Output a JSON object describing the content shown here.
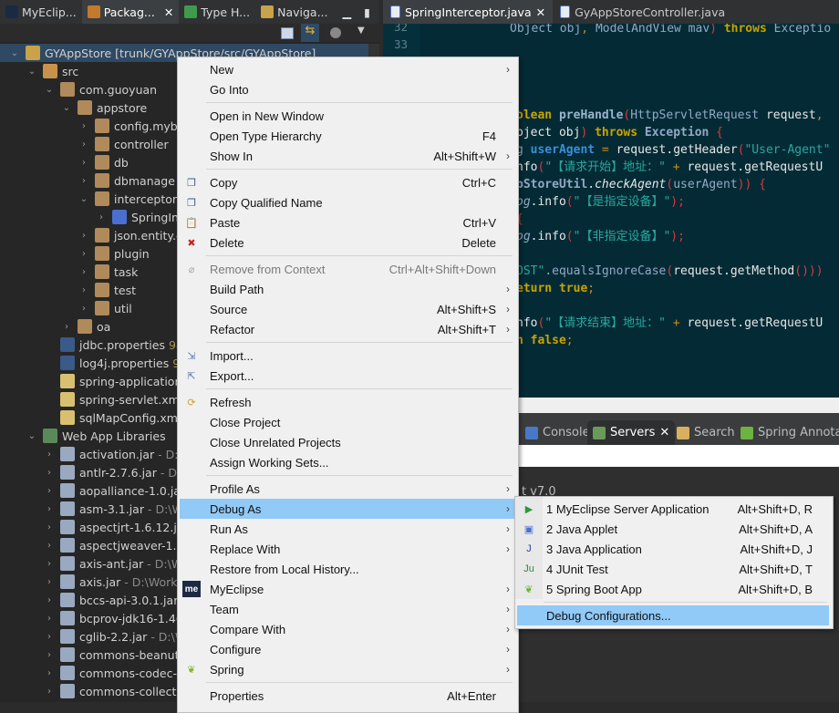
{
  "left_tabs": [
    {
      "label": "MyEclip...",
      "icon": "myeclipse-icon",
      "color": "#1b2a44"
    },
    {
      "label": "Packag...",
      "icon": "package-explorer-icon",
      "color": "#c47a2c",
      "active": true,
      "close": "✕"
    },
    {
      "label": "Type H...",
      "icon": "type-hierarchy-icon",
      "color": "#3f9a4d"
    },
    {
      "label": "Naviga...",
      "icon": "navigator-icon",
      "color": "#c9a24a"
    }
  ],
  "editor_tabs": [
    {
      "label": "SpringInterceptor.java",
      "active": true,
      "close": "✕"
    },
    {
      "label": "GyAppStoreController.java"
    }
  ],
  "tree": [
    {
      "label": "GYAppStore [trunk/GYAppStore/src/GYAppStore]",
      "level": 0,
      "exp": "v",
      "icon": "project-icon",
      "selected": true
    },
    {
      "label": "src",
      "level": 1,
      "exp": "v",
      "icon": "source-folder-icon"
    },
    {
      "label": "com.guoyuan",
      "level": 2,
      "exp": "v",
      "icon": "package-icon"
    },
    {
      "label": "appstore",
      "level": 3,
      "exp": "v",
      "icon": "package-icon"
    },
    {
      "label": "config.myba",
      "level": 4,
      "exp": ">",
      "icon": "package-icon"
    },
    {
      "label": "controller",
      "level": 4,
      "exp": ">",
      "icon": "package-icon"
    },
    {
      "label": "db",
      "level": 4,
      "exp": ">",
      "icon": "package-icon"
    },
    {
      "label": "dbmanage",
      "level": 4,
      "exp": ">",
      "icon": "package-icon"
    },
    {
      "label": "interceptor",
      "level": 4,
      "exp": "v",
      "icon": "package-icon"
    },
    {
      "label": "SpringIn",
      "level": 5,
      "exp": ">",
      "icon": "java-file-icon"
    },
    {
      "label": "json.entity.d",
      "level": 4,
      "exp": ">",
      "icon": "package-icon"
    },
    {
      "label": "plugin",
      "level": 4,
      "exp": ">",
      "icon": "package-icon"
    },
    {
      "label": "task",
      "level": 4,
      "exp": ">",
      "icon": "package-icon"
    },
    {
      "label": "test",
      "level": 4,
      "exp": ">",
      "icon": "package-icon"
    },
    {
      "label": "util",
      "level": 4,
      "exp": ">",
      "icon": "package-icon"
    },
    {
      "label": "oa",
      "level": 3,
      "exp": ">",
      "icon": "package-icon"
    },
    {
      "label": "jdbc.properties",
      "level": 2,
      "exp": "",
      "icon": "properties-file-icon",
      "deco": "98",
      "decoNum": true
    },
    {
      "label": "log4j.properties",
      "level": 2,
      "exp": "",
      "icon": "properties-file-icon",
      "deco": "98",
      "decoNum": true
    },
    {
      "label": "spring-application",
      "level": 2,
      "exp": "",
      "icon": "xml-file-icon"
    },
    {
      "label": "spring-servlet.xml",
      "level": 2,
      "exp": "",
      "icon": "xml-file-icon"
    },
    {
      "label": "sqlMapConfig.xml",
      "level": 2,
      "exp": "",
      "icon": "xml-file-icon"
    },
    {
      "label": "Web App Libraries",
      "level": 1,
      "exp": "v",
      "icon": "library-icon"
    },
    {
      "label": "activation.jar",
      "level": 2,
      "exp": ">",
      "icon": "jar-icon",
      "deco": "- D:\\W"
    },
    {
      "label": "antlr-2.7.6.jar",
      "level": 2,
      "exp": ">",
      "icon": "jar-icon",
      "deco": "- D:\\"
    },
    {
      "label": "aopalliance-1.0.jar",
      "level": 2,
      "exp": ">",
      "icon": "jar-icon"
    },
    {
      "label": "asm-3.1.jar",
      "level": 2,
      "exp": ">",
      "icon": "jar-icon",
      "deco": "- D:\\W"
    },
    {
      "label": "aspectjrt-1.6.12.jar",
      "level": 2,
      "exp": ">",
      "icon": "jar-icon"
    },
    {
      "label": "aspectjweaver-1.6.",
      "level": 2,
      "exp": ">",
      "icon": "jar-icon"
    },
    {
      "label": "axis-ant.jar",
      "level": 2,
      "exp": ">",
      "icon": "jar-icon",
      "deco": "- D:\\W"
    },
    {
      "label": "axis.jar",
      "level": 2,
      "exp": ">",
      "icon": "jar-icon",
      "deco": "- D:\\WorkS"
    },
    {
      "label": "bccs-api-3.0.1.jar",
      "level": 2,
      "exp": ">",
      "icon": "jar-icon",
      "deco": "-"
    },
    {
      "label": "bcprov-jdk16-1.46",
      "level": 2,
      "exp": ">",
      "icon": "jar-icon"
    },
    {
      "label": "cglib-2.2.jar",
      "level": 2,
      "exp": ">",
      "icon": "jar-icon",
      "deco": "- D:\\W"
    },
    {
      "label": "commons-beanutil",
      "level": 2,
      "exp": ">",
      "icon": "jar-icon"
    },
    {
      "label": "commons-codec-1",
      "level": 2,
      "exp": ">",
      "icon": "jar-icon"
    },
    {
      "label": "commons-collectio",
      "level": 2,
      "exp": ">",
      "icon": "jar-icon"
    }
  ],
  "editor": {
    "line_numbers": [
      "32",
      "33"
    ],
    "lines": [
      {
        "row": 0,
        "left": "full",
        "segs": [
          [
            "Object obj",
            "type"
          ],
          [
            ", ",
            "op"
          ],
          [
            "ModelAndView mav",
            "type"
          ],
          [
            ")",
            "br"
          ],
          [
            " throws ",
            "kw"
          ],
          [
            "Exceptio",
            "type"
          ]
        ]
      },
      {
        "row": 5,
        "segs": [
          [
            "olean",
            "kw"
          ],
          [
            " preHandle",
            "method"
          ],
          [
            "(",
            "br"
          ],
          [
            "HttpServletRequest",
            "type"
          ],
          [
            " request",
            "plain"
          ],
          [
            ",",
            "op"
          ]
        ]
      },
      {
        "row": 6,
        "segs": [
          [
            "bject obj",
            "plain"
          ],
          [
            ")",
            "br"
          ],
          [
            " throws ",
            "kw"
          ],
          [
            "Exception",
            "tb"
          ],
          [
            " {",
            "br"
          ]
        ]
      },
      {
        "row": 7,
        "segs": [
          [
            "g ",
            "type"
          ],
          [
            "userAgent",
            "var"
          ],
          [
            " = ",
            "op"
          ],
          [
            "request.getHeader",
            "plain"
          ],
          [
            "(",
            "br"
          ],
          [
            "\"User-Agent\"",
            "str"
          ]
        ]
      },
      {
        "row": 8,
        "segs": [
          [
            "nfo",
            "plain"
          ],
          [
            "(",
            "br"
          ],
          [
            "\"【请求开始】地址：\"",
            "str"
          ],
          [
            " + ",
            "op"
          ],
          [
            "request.getRequestU",
            "plain"
          ]
        ]
      },
      {
        "row": 9,
        "segs": [
          [
            "pStoreUtil",
            "tb"
          ],
          [
            ".",
            "plain"
          ],
          [
            "checkAgent",
            "plain it"
          ],
          [
            "(",
            "br"
          ],
          [
            "userAgent",
            "type"
          ],
          [
            ")) {",
            "br"
          ]
        ]
      },
      {
        "row": 10,
        "segs": [
          [
            "og",
            "type it"
          ],
          [
            ".info",
            "plain"
          ],
          [
            "(",
            "br"
          ],
          [
            "\"【是指定设备】\"",
            "str"
          ],
          [
            ");",
            "br"
          ]
        ]
      },
      {
        "row": 11,
        "segs": [
          [
            "{",
            "br"
          ]
        ]
      },
      {
        "row": 12,
        "segs": [
          [
            "og",
            "type it"
          ],
          [
            ".info",
            "plain"
          ],
          [
            "(",
            "br"
          ],
          [
            "\"【非指定设备】\"",
            "str"
          ],
          [
            ");",
            "br"
          ]
        ]
      },
      {
        "row": 14,
        "segs": [
          [
            "OST\"",
            "str"
          ],
          [
            ".equalsIgnoreCase",
            "type"
          ],
          [
            "(",
            "br"
          ],
          [
            "request.getMethod",
            "plain"
          ],
          [
            "()))",
            "br"
          ]
        ]
      },
      {
        "row": 15,
        "segs": [
          [
            "eturn true",
            "kw"
          ],
          [
            ";",
            "op"
          ]
        ]
      },
      {
        "row": 17,
        "segs": [
          [
            "nfo",
            "plain"
          ],
          [
            "(",
            "br"
          ],
          [
            "\"【请求结束】地址：\"",
            "str"
          ],
          [
            " + ",
            "op"
          ],
          [
            "request.getRequestU",
            "plain"
          ]
        ]
      },
      {
        "row": 18,
        "segs": [
          [
            "n false",
            "kw"
          ],
          [
            ";",
            "op"
          ]
        ]
      }
    ]
  },
  "bottom_tabs": [
    {
      "label": "Console",
      "icon": "console-icon"
    },
    {
      "label": "Servers",
      "icon": "servers-icon",
      "active": true,
      "close": "✕"
    },
    {
      "label": "Search",
      "icon": "search-icon"
    },
    {
      "label": "Spring Annotatio",
      "icon": "spring-icon"
    }
  ],
  "servers_fragment": "t v7.0",
  "context_menu": [
    {
      "label": "New",
      "submenu": true
    },
    {
      "label": "Go Into"
    },
    {
      "sep": true
    },
    {
      "label": "Open in New Window"
    },
    {
      "label": "Open Type Hierarchy",
      "key": "F4"
    },
    {
      "label": "Show In",
      "key": "Alt+Shift+W",
      "submenu": true
    },
    {
      "sep": true
    },
    {
      "label": "Copy",
      "key": "Ctrl+C",
      "icon": "copy-icon"
    },
    {
      "label": "Copy Qualified Name",
      "icon": "copy-qualified-name-icon"
    },
    {
      "label": "Paste",
      "key": "Ctrl+V",
      "icon": "paste-icon"
    },
    {
      "label": "Delete",
      "key": "Delete",
      "icon": "delete-icon"
    },
    {
      "sep": true
    },
    {
      "label": "Remove from Context",
      "key": "Ctrl+Alt+Shift+Down",
      "disabled": true,
      "icon": "remove-context-icon"
    },
    {
      "label": "Build Path",
      "submenu": true
    },
    {
      "label": "Source",
      "key": "Alt+Shift+S",
      "submenu": true
    },
    {
      "label": "Refactor",
      "key": "Alt+Shift+T",
      "submenu": true
    },
    {
      "sep": true
    },
    {
      "label": "Import...",
      "icon": "import-icon"
    },
    {
      "label": "Export...",
      "icon": "export-icon"
    },
    {
      "sep": true
    },
    {
      "label": "Refresh",
      "icon": "refresh-icon"
    },
    {
      "label": "Close Project"
    },
    {
      "label": "Close Unrelated Projects"
    },
    {
      "label": "Assign Working Sets..."
    },
    {
      "sep": true
    },
    {
      "label": "Profile As",
      "submenu": true
    },
    {
      "label": "Debug As",
      "submenu": true,
      "highlighted": true
    },
    {
      "label": "Run As",
      "submenu": true
    },
    {
      "label": "Replace With",
      "submenu": true
    },
    {
      "label": "Restore from Local History..."
    },
    {
      "label": "MyEclipse",
      "submenu": true,
      "icon": "myeclipse-icon"
    },
    {
      "label": "Team",
      "submenu": true
    },
    {
      "label": "Compare With",
      "submenu": true
    },
    {
      "label": "Configure",
      "submenu": true
    },
    {
      "label": "Spring",
      "submenu": true,
      "icon": "spring-leaf-icon"
    },
    {
      "sep": true
    },
    {
      "label": "Properties",
      "key": "Alt+Enter"
    }
  ],
  "debug_submenu": [
    {
      "label": "1 MyEclipse Server Application",
      "key": "Alt+Shift+D, R",
      "icon": "server-application-icon"
    },
    {
      "label": "2 Java Applet",
      "key": "Alt+Shift+D, A",
      "icon": "java-applet-icon"
    },
    {
      "label": "3 Java Application",
      "key": "Alt+Shift+D, J",
      "icon": "java-application-icon"
    },
    {
      "label": "4 JUnit Test",
      "key": "Alt+Shift+D, T",
      "icon": "junit-icon"
    },
    {
      "label": "5 Spring Boot App",
      "key": "Alt+Shift+D, B",
      "icon": "spring-boot-icon"
    },
    {
      "sep": true
    },
    {
      "label": "Debug Configurations...",
      "highlighted": true
    }
  ],
  "colors": {
    "menu_highlight": "#91c9f7",
    "editor_bg": "#042b35",
    "tree_selection": "#2f4963"
  }
}
